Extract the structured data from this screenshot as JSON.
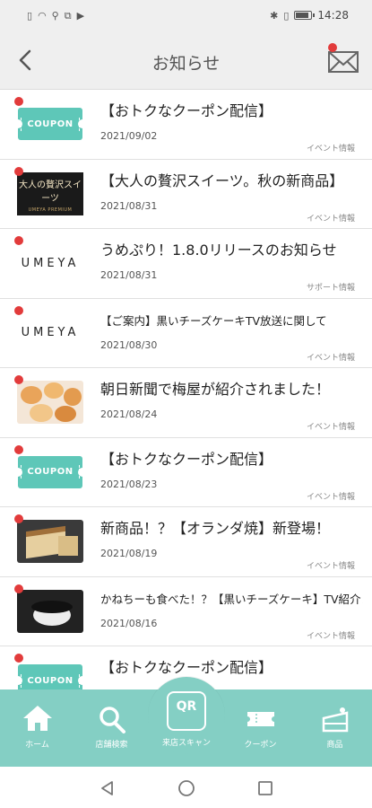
{
  "status_bar": {
    "time": "14:28",
    "battery_level": 0.85,
    "left_icons": [
      "sim-icon",
      "wifi-icon",
      "usb-icon",
      "usb-debug-icon",
      "youtube-icon"
    ],
    "right_icons": [
      "bluetooth-icon",
      "vibrate-icon",
      "battery-icon"
    ]
  },
  "header": {
    "title": "お知らせ",
    "back_icon": "chevron-left-icon",
    "mail_icon": "envelope-icon",
    "mail_has_unread": true,
    "accent": "#e23b3b"
  },
  "notices": [
    {
      "title": "【おトクなクーポン配信】",
      "date": "2021/09/02",
      "category": "イベント情報",
      "thumb": "coupon",
      "unread": true
    },
    {
      "title": "【大人の贅沢スイーツ。秋の新商品】",
      "date": "2021/08/31",
      "category": "イベント情報",
      "thumb": "sweets",
      "unread": true
    },
    {
      "title": "うめぷり！1.8.0リリースのお知らせ",
      "date": "2021/08/31",
      "category": "サポート情報",
      "thumb": "umeya",
      "unread": true
    },
    {
      "title": "【ご案内】黒いチーズケーキTV放送に関して",
      "date": "2021/08/30",
      "category": "イベント情報",
      "thumb": "umeya",
      "unread": true,
      "small": true
    },
    {
      "title": "朝日新聞で梅屋が紹介されました！",
      "date": "2021/08/24",
      "category": "イベント情報",
      "thumb": "bread",
      "unread": true
    },
    {
      "title": "【おトクなクーポン配信】",
      "date": "2021/08/23",
      "category": "イベント情報",
      "thumb": "coupon",
      "unread": true
    },
    {
      "title": "新商品！？【オランダ焼】新登場！",
      "date": "2021/08/19",
      "category": "イベント情報",
      "thumb": "cake1",
      "unread": true
    },
    {
      "title": "かねちーも食べた！？【黒いチーズケーキ】TV紹介！！",
      "date": "2021/08/16",
      "category": "イベント情報",
      "thumb": "cake2",
      "unread": true,
      "small": true
    },
    {
      "title": "【おトクなクーポン配信】",
      "date": "",
      "category": "",
      "thumb": "coupon",
      "unread": true
    }
  ],
  "thumb_text": {
    "coupon": "COUPON",
    "umeya": "UMEYA",
    "sweets_main": "大人の贅沢スイーツ",
    "sweets_sub": "UMEYA PREMIUM"
  },
  "tabs": [
    {
      "label": "ホーム",
      "icon": "home-icon"
    },
    {
      "label": "店舗検索",
      "icon": "search-icon"
    },
    {
      "label": "来店スキャン",
      "icon": "qr-icon",
      "center_text": "QR"
    },
    {
      "label": "クーポン",
      "icon": "ticket-icon"
    },
    {
      "label": "商品",
      "icon": "cake-icon"
    }
  ],
  "colors": {
    "tabbar": "#84cfc4",
    "coupon": "#5ec7b8",
    "unread_dot": "#e23b3b"
  }
}
